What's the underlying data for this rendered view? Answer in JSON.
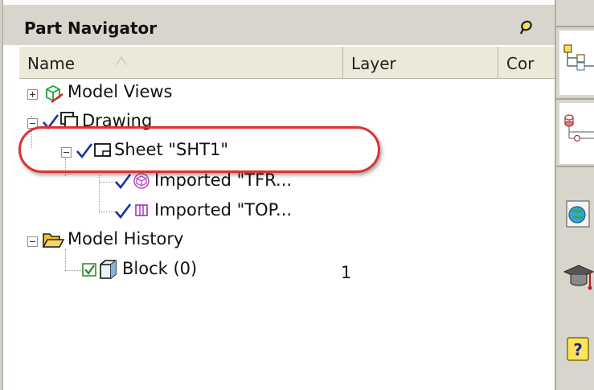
{
  "panel": {
    "title": "Part Navigator",
    "pin_icon": "pin-icon"
  },
  "columns": [
    "Name",
    "Layer",
    "Cor"
  ],
  "tree": {
    "model_views": {
      "label": "Model Views",
      "icon": "model-views-icon"
    },
    "drawing": {
      "label": "Drawing",
      "icon": "drawing-icon"
    },
    "sheet": {
      "label": "Sheet \"SHT1\"",
      "icon": "sheet-icon"
    },
    "imported1": {
      "label": "Imported \"TFR...",
      "icon": "imported-view-icon"
    },
    "imported2": {
      "label": "Imported \"TOP...",
      "icon": "imported-view-icon"
    },
    "model_history": {
      "label": "Model History",
      "icon": "folder-open-icon"
    },
    "block": {
      "label": "Block (0)",
      "layer": "1",
      "icon": "block-icon"
    }
  },
  "resource_bar": {
    "icons": [
      "assembly-navigator-icon",
      "constraint-navigator-icon",
      "web-browser-icon",
      "roles-icon",
      "help-icon"
    ]
  },
  "colors": {
    "highlight": "#e03030",
    "check": "#1a2fa8",
    "panel_gray": "#d8d5cd"
  }
}
